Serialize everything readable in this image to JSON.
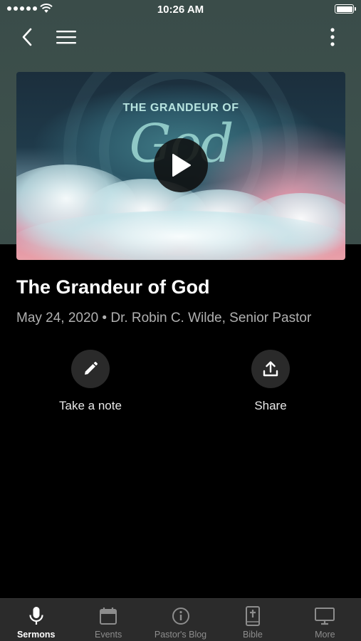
{
  "status_bar": {
    "time": "10:26 AM"
  },
  "header": {
    "icons": [
      "chevron-left-icon",
      "hamburger-menu-icon",
      "more-vertical-icon"
    ]
  },
  "video": {
    "thumbnail_title_top": "THE GRANDEUR OF",
    "thumbnail_title_script": "God",
    "icon": "play-icon"
  },
  "sermon": {
    "title": "The Grandeur of God",
    "meta": "May 24, 2020 • Dr. Robin C. Wilde, Senior Pastor"
  },
  "actions": [
    {
      "label": "Take a note",
      "icon": "pencil-icon"
    },
    {
      "label": "Share",
      "icon": "share-upload-icon"
    }
  ],
  "tab_bar": {
    "active": "Sermons",
    "tabs": [
      {
        "label": "Sermons",
        "icon": "microphone-icon"
      },
      {
        "label": "Events",
        "icon": "calendar-icon"
      },
      {
        "label": "Pastor's Blog",
        "icon": "info-icon"
      },
      {
        "label": "Bible",
        "icon": "bible-icon"
      },
      {
        "label": "More",
        "icon": "monitor-icon"
      }
    ]
  },
  "colors": {
    "header_bg": "#3d504c",
    "page_bg": "#000000",
    "tab_bar_bg": "#2b2b2b",
    "action_circle_bg": "#2a2a2a",
    "meta_text": "#b0b0b0"
  }
}
